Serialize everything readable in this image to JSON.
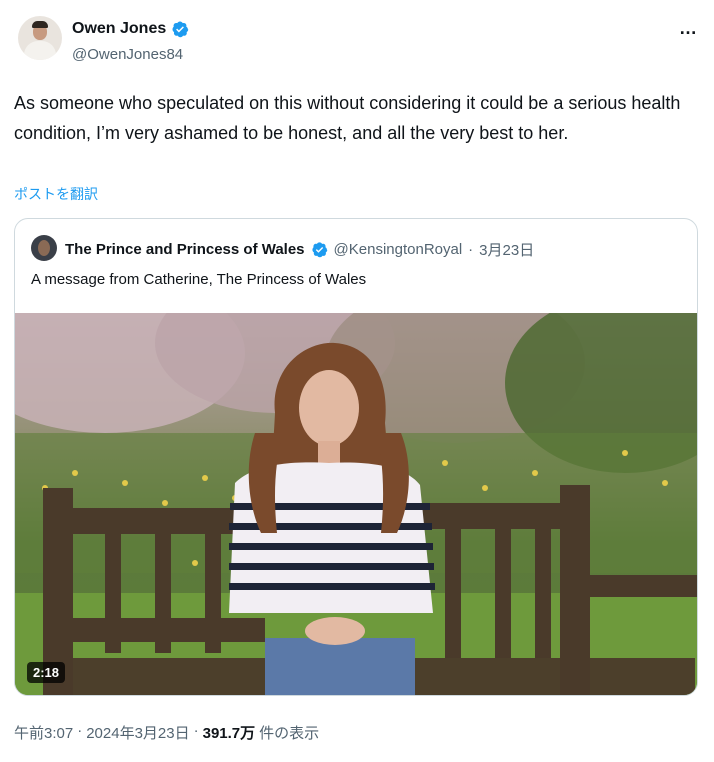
{
  "author": {
    "display_name": "Owen Jones",
    "handle": "@OwenJones84"
  },
  "more_icon": "…",
  "tweet_text": "As someone who speculated on this without considering it could be a serious health condition, I’m very ashamed to be honest, and all the very best to her.",
  "translate_label": "ポストを翻訳",
  "quoted": {
    "display_name": "The Prince and Princess of Wales",
    "handle": "@KensingtonRoyal",
    "separator": "·",
    "date": "3月23日",
    "text": "A message from Catherine, The Princess of Wales",
    "video_duration": "2:18"
  },
  "meta": {
    "time": "午前3:07",
    "sep1": "·",
    "date": "2024年3月23日",
    "sep2": "·",
    "views_count": "391.7万",
    "views_label": "件の表示"
  },
  "colors": {
    "verified": "#1d9bf0",
    "link": "#1d9bf0",
    "secondary_text": "#536471"
  }
}
